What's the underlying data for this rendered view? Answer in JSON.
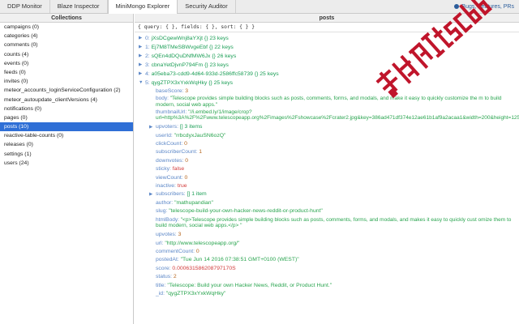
{
  "tabs": [
    {
      "label": "DDP Monitor"
    },
    {
      "label": "Blaze Inspector"
    },
    {
      "label": "MiniMongo Explorer"
    },
    {
      "label": "Security Auditor"
    }
  ],
  "active_tab": "MiniMongo Explorer",
  "bugs_link": "Bugs, Features, PRs",
  "collections_title": "Collections",
  "collections": [
    "campaigns (0)",
    "categories (4)",
    "comments (0)",
    "counts (4)",
    "events (0)",
    "feeds (0)",
    "invites (0)",
    "meteor_accounts_loginServiceConfiguration (2)",
    "meteor_autoupdate_clientVersions (4)",
    "notifications (0)",
    "pages (0)",
    "posts (10)",
    "reactive-table-counts (0)",
    "releases (0)",
    "settings (1)",
    "users (24)"
  ],
  "selected_collection": "posts (10)",
  "docs_title": "posts",
  "query": "{ query: { }, fields: { }, sort: { } }",
  "collapsed_docs": [
    {
      "index": "0:",
      "id": "jXsDCgewWnj8aYXjt",
      "braces": "{}",
      "count": "23 keys"
    },
    {
      "index": "1:",
      "id": "Ej7M8TMeSBWvgeEbf",
      "braces": "{}",
      "count": "22 keys"
    },
    {
      "index": "2:",
      "id": "sQEn4dDQuDNfMW6Jx",
      "braces": "{}",
      "count": "26 keys"
    },
    {
      "index": "3:",
      "id": "cbnaYetDjvnP794Fm",
      "braces": "{}",
      "count": "23 keys"
    },
    {
      "index": "4:",
      "id": "a05eba73-cdd9-4d64-933d-2586ffc58739",
      "braces": "{}",
      "count": "25 keys"
    }
  ],
  "expanded_doc": {
    "index": "5:",
    "id": "qygZTPX3xYxkWqHky",
    "braces": "{}",
    "count": "25 keys"
  },
  "fields": {
    "baseScore_k": "baseScore:",
    "baseScore_v": "3",
    "body_k": "body:",
    "body_v": "\"Telescope provides simple building blocks such as posts, comments, forms, and modals, and make it easy to quickly customize the m to build modern, social web apps.\"",
    "thumb_k": "thumbnailUrl:",
    "thumb_v": "\"//i.embed.ly/1/image/crop?url=http%3A%2F%2Fwww.telescopeapp.org%2Fimages%2Fshowcase%2Fcrater2.jpg&key=386ad471df374e12ae61b1af9a2acaa1&width=200&height=125\"",
    "upvoters_k": "upvoters:",
    "upvoters_b": "[]",
    "upvoters_c": "3 items",
    "userId_k": "userId:",
    "userId_v": "\"rrbcdyxJauSN6ozQ\"",
    "clickCount_k": "clickCount:",
    "clickCount_v": "0",
    "subscriberCount_k": "subscriberCount:",
    "subscriberCount_v": "1",
    "downvotes_k": "downvotes:",
    "downvotes_v": "0",
    "sticky_k": "sticky:",
    "sticky_v": "false",
    "viewCount_k": "viewCount:",
    "viewCount_v": "0",
    "inactive_k": "inactive:",
    "inactive_v": "true",
    "subscribers_k": "subscribers:",
    "subscribers_b": "[]",
    "subscribers_c": "1 item",
    "author_k": "author:",
    "author_v": "\"mathupandian\"",
    "slug_k": "slug:",
    "slug_v": "\"telescope-build-your-own-hacker-news-reddit-or-product-hunt\"",
    "htmlBody_k": "htmlBody:",
    "htmlBody_v": "\"<p>Telescope provides simple building blocks such as posts, comments, forms, and modals, and makes it easy to quickly cust omize them to build modern, social web apps.</p> \"",
    "upvotes_k": "upvotes:",
    "upvotes_v": "3",
    "url_k": "url:",
    "url_v": "\"http://www.telescopeapp.org/\"",
    "commentCount_k": "commentCount:",
    "commentCount_v": "0",
    "postedAt_k": "postedAt:",
    "postedAt_v": "\"Tue Jun 14 2016 07:38:51 GMT+0100 (WEST)\"",
    "score_k": "score:",
    "score_v": "0.000631586208797170S",
    "status_k": "status:",
    "status_v": "2",
    "title_k": "title:",
    "title_v": "\"Telescope: Build your own Hacker News, Reddit, or Product Hunt.\"",
    "_id_k": "_id:",
    "_id_v": "\"qygZTPX3xYxkWqHky\""
  },
  "watermark": "数创Itsc566",
  "colors": {
    "selected": "#2f6fd6",
    "key": "#5c87c7",
    "string": "#28a44e",
    "number": "#b5651d",
    "boolean": "#d13a3a",
    "watermark": "#c0152b"
  }
}
